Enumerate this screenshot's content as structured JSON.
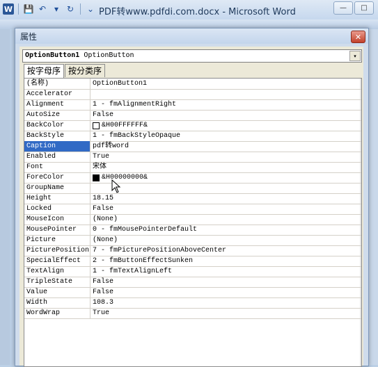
{
  "word": {
    "title": "PDF转www.pdfdi.com.docx - Microsoft Word",
    "logo": "W",
    "qat": {
      "save": "💾",
      "undo": "↶",
      "dropdown": "▾",
      "redo": "↻",
      "customize": "⌄"
    },
    "controls": {
      "minimize": "—",
      "maximize": "□",
      "close": "✕"
    }
  },
  "dialog": {
    "title": "属性",
    "close": "✕",
    "object": {
      "name": "OptionButton1",
      "type": "OptionButton",
      "dropdown_arrow": "▾"
    },
    "tabs": [
      {
        "label": "按字母序",
        "active": true
      },
      {
        "label": "按分类序",
        "active": false
      }
    ],
    "properties": [
      {
        "name": "(名称)",
        "value": "OptionButton1"
      },
      {
        "name": "Accelerator",
        "value": ""
      },
      {
        "name": "Alignment",
        "value": "1 - fmAlignmentRight"
      },
      {
        "name": "AutoSize",
        "value": "False"
      },
      {
        "name": "BackColor",
        "value": "&H00FFFFFF&",
        "swatch": "#ffffff"
      },
      {
        "name": "BackStyle",
        "value": "1 - fmBackStyleOpaque"
      },
      {
        "name": "Caption",
        "value": "pdf转word",
        "selected": true
      },
      {
        "name": "Enabled",
        "value": "True"
      },
      {
        "name": "Font",
        "value": "宋体"
      },
      {
        "name": "ForeColor",
        "value": "&H00000000&",
        "swatch": "#000000"
      },
      {
        "name": "GroupName",
        "value": ""
      },
      {
        "name": "Height",
        "value": "18.15"
      },
      {
        "name": "Locked",
        "value": "False"
      },
      {
        "name": "MouseIcon",
        "value": "(None)"
      },
      {
        "name": "MousePointer",
        "value": "0 - fmMousePointerDefault"
      },
      {
        "name": "Picture",
        "value": "(None)"
      },
      {
        "name": "PicturePosition",
        "value": "7 - fmPicturePositionAboveCenter"
      },
      {
        "name": "SpecialEffect",
        "value": "2 - fmButtonEffectSunken"
      },
      {
        "name": "TextAlign",
        "value": "1 - fmTextAlignLeft"
      },
      {
        "name": "TripleState",
        "value": "False"
      },
      {
        "name": "Value",
        "value": "False"
      },
      {
        "name": "Width",
        "value": "108.3"
      },
      {
        "name": "WordWrap",
        "value": "True"
      }
    ]
  }
}
